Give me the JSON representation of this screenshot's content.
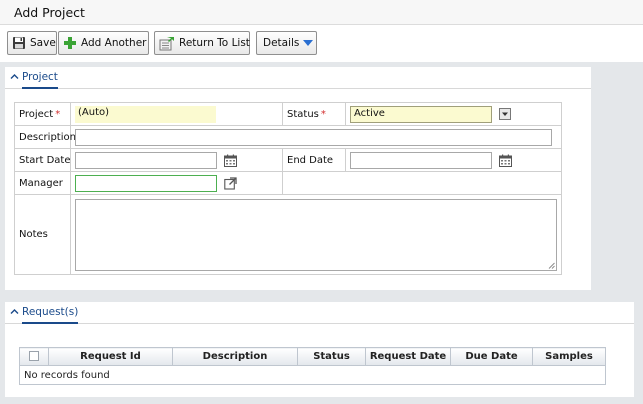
{
  "page": {
    "title": "Add Project"
  },
  "toolbar": {
    "save_label": "Save",
    "add_another_label": "Add Another",
    "return_label": "Return To List",
    "details_label": "Details"
  },
  "project_section": {
    "label": "Project",
    "fields": {
      "project_label": "Project",
      "project_value": "(Auto)",
      "status_label": "Status",
      "status_value": "Active",
      "description_label": "Description",
      "description_value": "",
      "start_date_label": "Start Date",
      "start_date_value": "",
      "end_date_label": "End Date",
      "end_date_value": "",
      "manager_label": "Manager",
      "manager_value": "",
      "notes_label": "Notes",
      "notes_value": ""
    },
    "required_marker": "*"
  },
  "requests_section": {
    "label": "Request(s)",
    "columns": [
      "Request Id",
      "Description",
      "Status",
      "Request Date",
      "Due Date",
      "Samples"
    ],
    "empty_message": "No records found"
  },
  "colors": {
    "accent": "#1a4a8a",
    "required": "#d32f2f",
    "highlight_field": "#fbfad0",
    "add_icon_green": "#3aa335",
    "details_arrow_blue": "#2a6fd1"
  }
}
